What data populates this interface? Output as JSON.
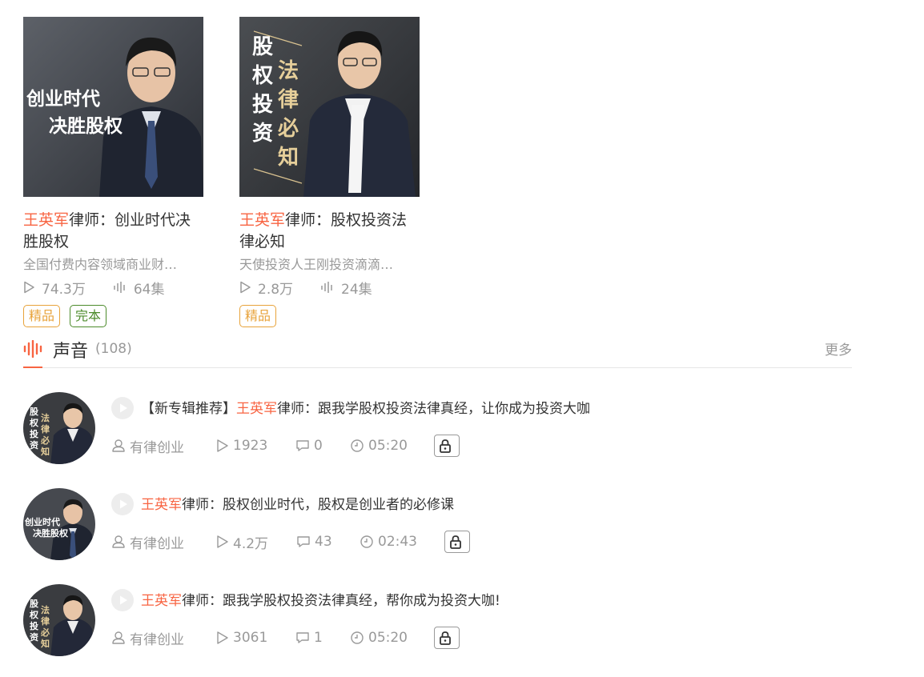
{
  "albums": [
    {
      "title_highlight": "王英军",
      "title_rest": "律师：创业时代决胜股权",
      "cover_text": [
        "创业时代",
        "决胜股权"
      ],
      "description": "全国付费内容领域商业财…",
      "plays": "74.3万",
      "episodes": "64集",
      "badges": [
        "精品",
        "完本"
      ]
    },
    {
      "title_highlight": "王英军",
      "title_rest": "律师：股权投资法律必知",
      "cover_text": [
        "股",
        "权",
        "投",
        "资",
        "法",
        "律",
        "必",
        "知"
      ],
      "description": "天使投资人王刚投资滴滴…",
      "plays": "2.8万",
      "episodes": "24集",
      "badges": [
        "精品"
      ]
    }
  ],
  "section": {
    "title": "声音",
    "count": "(108)",
    "more": "更多"
  },
  "tracks": [
    {
      "prefix": "【新专辑推荐】",
      "title_highlight": "王英军",
      "title_rest": "律师：跟我学股权投资法律真经，让你成为投资大咖",
      "author": "有律创业",
      "plays": "1923",
      "comments": "0",
      "duration": "05:20"
    },
    {
      "prefix": "",
      "title_highlight": "王英军",
      "title_rest": "律师：股权创业时代，股权是创业者的必修课",
      "author": "有律创业",
      "plays": "4.2万",
      "comments": "43",
      "duration": "02:43"
    },
    {
      "prefix": "",
      "title_highlight": "王英军",
      "title_rest": "律师：跟我学股权投资法律真经，帮你成为投资大咖!",
      "author": "有律创业",
      "plays": "3061",
      "comments": "1",
      "duration": "05:20"
    }
  ],
  "colors": {
    "accent": "#f86442",
    "muted": "#999999",
    "gold_badge": "#e8a33b",
    "green_badge": "#4c8b2b"
  }
}
